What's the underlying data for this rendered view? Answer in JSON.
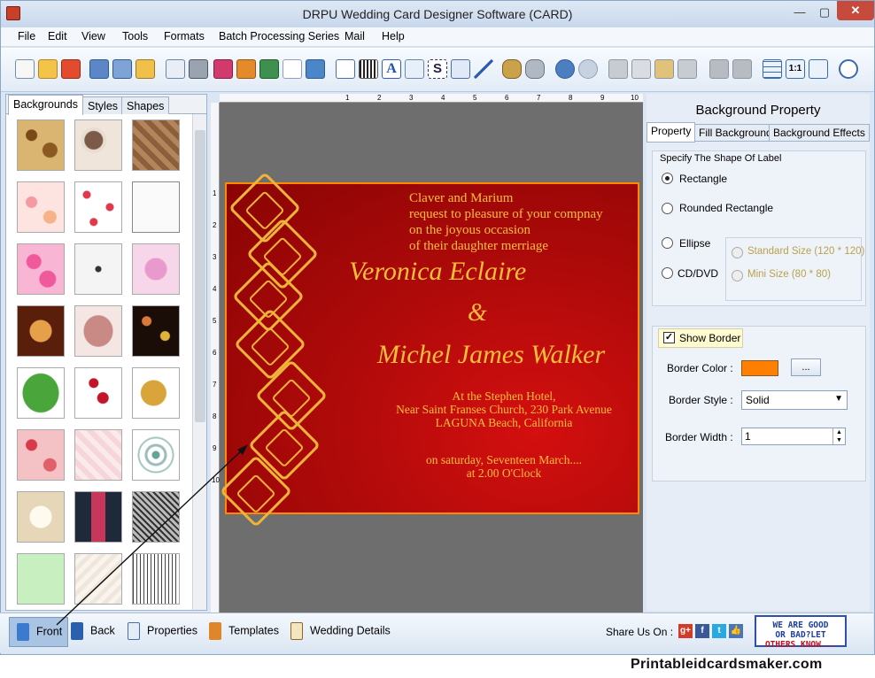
{
  "window": {
    "title": "DRPU Wedding Card Designer Software (CARD)",
    "min": "—",
    "max": "▢",
    "close": "✕"
  },
  "menu": [
    "File",
    "Edit",
    "View",
    "Tools",
    "Formats",
    "Batch Processing Series",
    "Mail",
    "Help"
  ],
  "left_panel": {
    "tabs": [
      "Backgrounds",
      "Styles",
      "Shapes"
    ]
  },
  "card": {
    "line1": "Claver and Marium",
    "line2": "request to pleasure of your compnay",
    "line3": "on the joyous occasion",
    "line4": "of their daughter merriage",
    "bride": "Veronica Eclaire",
    "amp": "&",
    "groom": "Michel James Walker",
    "venue1": "At the Stephen Hotel,",
    "venue2": "Near Saint Franses Church, 230 Park Avenue",
    "venue3": "LAGUNA Beach, California",
    "date1": "on saturday, Seventeen March....",
    "date2": "at 2.00 O'Clock"
  },
  "ruler_h": [
    "1",
    "2",
    "3",
    "4",
    "5",
    "6",
    "7",
    "8",
    "9",
    "10"
  ],
  "ruler_v": [
    "1",
    "2",
    "3",
    "4",
    "5",
    "6",
    "7",
    "8",
    "9",
    "10"
  ],
  "right_panel": {
    "title": "Background Property",
    "tabs": [
      "Property",
      "Fill Background",
      "Background Effects"
    ],
    "shape_group_label": "Specify The Shape Of Label",
    "shapes": {
      "rectangle": "Rectangle",
      "rounded": "Rounded Rectangle",
      "ellipse": "Ellipse",
      "cddvd": "CD/DVD"
    },
    "sizes": {
      "standard": "Standard Size (120 * 120)",
      "mini": "Mini Size (80 * 80)"
    },
    "show_border": "Show Border",
    "border_color_label": "Border Color :",
    "border_color": "#ff8000",
    "dots_button": "...",
    "border_style_label": "Border Style :",
    "border_style": "Solid",
    "border_width_label": "Border Width :",
    "border_width": "1"
  },
  "bottom": {
    "buttons": [
      "Front",
      "Back",
      "Properties",
      "Templates",
      "Wedding Details"
    ],
    "share_label": "Share Us On :",
    "badge_line1": "WE ARE GOOD",
    "badge_line2": "OR BAD?LET",
    "badge_line3": "OTHERS KNOW..."
  },
  "footer": "Printableidcardsmaker.com"
}
